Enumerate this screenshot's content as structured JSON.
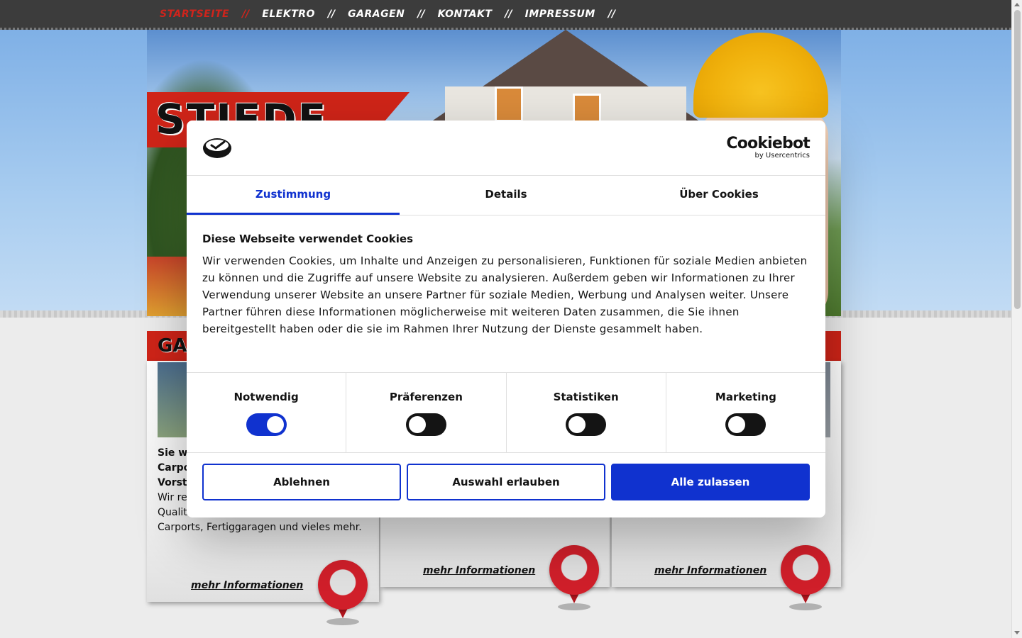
{
  "nav": {
    "items": [
      {
        "label": "STARTSEITE",
        "active": true
      },
      {
        "label": "ELEKTRO",
        "active": false
      },
      {
        "label": "GARAGEN",
        "active": false
      },
      {
        "label": "KONTAKT",
        "active": false
      },
      {
        "label": "IMPRESSUM",
        "active": false
      }
    ],
    "separator": "//"
  },
  "header": {
    "logo_text": "STIEDE"
  },
  "content": {
    "heading": "GA",
    "boxes": [
      {
        "title": "Sie w\nCarpo\nVorst",
        "text": "Wir re\nQualit\nCarports, Fertiggaragen und vieles mehr.",
        "link": "mehr Informationen"
      },
      {
        "link": "mehr Informationen"
      },
      {
        "link": "mehr Informationen"
      }
    ]
  },
  "cookie_dialog": {
    "brand": "Cookiebot",
    "brand_sub": "by Usercentrics",
    "tabs": [
      {
        "label": "Zustimmung",
        "active": true
      },
      {
        "label": "Details",
        "active": false
      },
      {
        "label": "Über Cookies",
        "active": false
      }
    ],
    "heading": "Diese Webseite verwendet Cookies",
    "text": "Wir verwenden Cookies, um Inhalte und Anzeigen zu personalisieren, Funktionen für soziale Medien anbieten zu können und die Zugriffe auf unsere Website zu analysieren. Außerdem geben wir Informationen zu Ihrer Verwendung unserer Website an unsere Partner für soziale Medien, Werbung und Analysen weiter. Unsere Partner führen diese Informationen möglicherweise mit weiteren Daten zusammen, die Sie ihnen bereitgestellt haben oder die sie im Rahmen Ihrer Nutzung der Dienste gesammelt haben.",
    "categories": [
      {
        "label": "Notwendig",
        "checked": true
      },
      {
        "label": "Präferenzen",
        "checked": false
      },
      {
        "label": "Statistiken",
        "checked": false
      },
      {
        "label": "Marketing",
        "checked": false
      }
    ],
    "buttons": {
      "decline": "Ablehnen",
      "allow_selection": "Auswahl erlauben",
      "allow_all": "Alle zulassen"
    }
  },
  "colors": {
    "accent_red": "#cf2418",
    "cookie_blue": "#1032cf",
    "nav_bg": "#3c3c3c"
  }
}
